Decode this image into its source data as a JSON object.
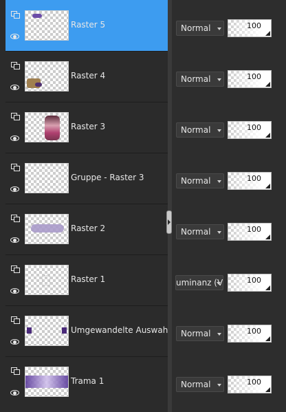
{
  "layers": [
    {
      "name": "Raster 5",
      "blend": "Normal",
      "opacity": "100",
      "selected": true
    },
    {
      "name": "Raster 4",
      "blend": "Normal",
      "opacity": "100",
      "selected": false
    },
    {
      "name": "Raster 3",
      "blend": "Normal",
      "opacity": "100",
      "selected": false
    },
    {
      "name": "Gruppe - Raster 3",
      "blend": "Normal",
      "opacity": "100",
      "selected": false
    },
    {
      "name": "Raster 2",
      "blend": "Normal",
      "opacity": "100",
      "selected": false
    },
    {
      "name": "Raster 1",
      "blend": "uminanz (V",
      "opacity": "100",
      "selected": false
    },
    {
      "name": "Umgewandelte Auswahl",
      "blend": "Normal",
      "opacity": "100",
      "selected": false
    },
    {
      "name": "Trama 1",
      "blend": "Normal",
      "opacity": "100",
      "selected": false
    }
  ],
  "colors": {
    "selected_row": "#3d9cf0",
    "panel_bg": "#2b2b2b"
  }
}
